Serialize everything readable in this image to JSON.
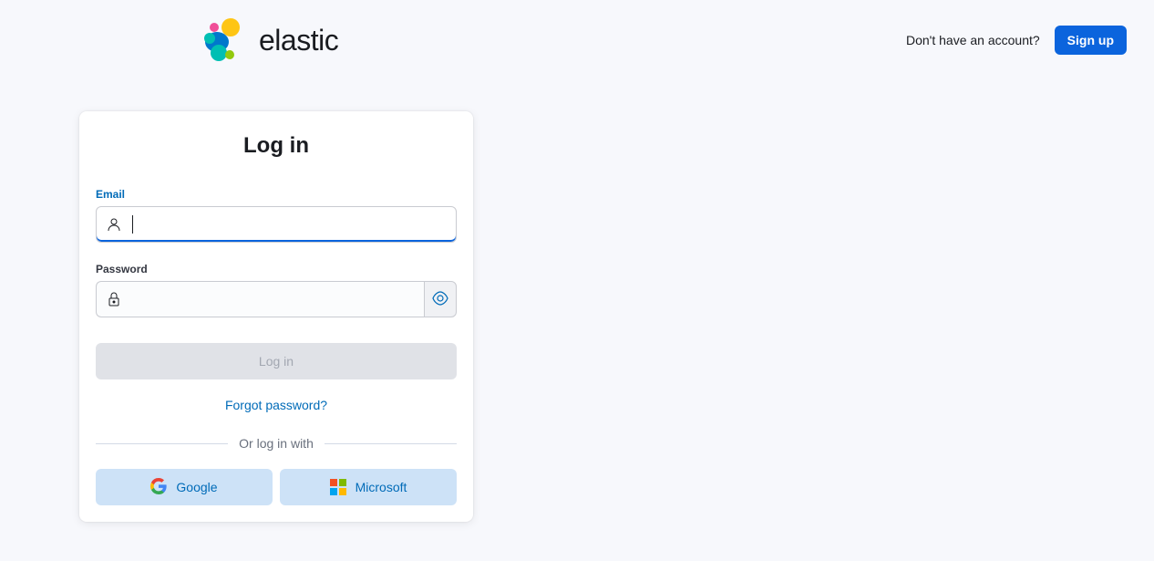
{
  "header": {
    "brand": "elastic",
    "no_account_text": "Don't have an account?",
    "signup_label": "Sign up"
  },
  "card": {
    "title": "Log in",
    "email_label": "Email",
    "password_label": "Password",
    "login_button": "Log in",
    "forgot_link": "Forgot password?",
    "divider_text": "Or log in with",
    "google_label": "Google",
    "microsoft_label": "Microsoft"
  }
}
